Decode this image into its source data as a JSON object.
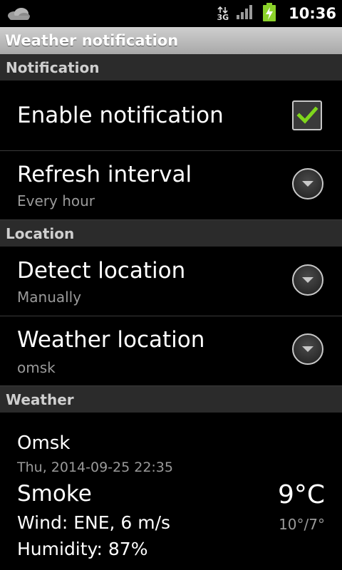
{
  "statusbar": {
    "network_type": "3G",
    "time": "10:36",
    "icons": [
      "weather-cloud-icon",
      "network-3g-icon",
      "signal-bars-icon",
      "battery-charging-icon"
    ]
  },
  "titlebar": {
    "title": "Weather notification"
  },
  "sections": {
    "notification": "Notification",
    "location": "Location",
    "weather": "Weather"
  },
  "prefs": {
    "enable_notification": {
      "title": "Enable notification",
      "checked": true
    },
    "refresh_interval": {
      "title": "Refresh interval",
      "summary": "Every hour"
    },
    "detect_location": {
      "title": "Detect location",
      "summary": "Manually"
    },
    "weather_location": {
      "title": "Weather location",
      "summary": "omsk"
    }
  },
  "weather": {
    "city": "Omsk",
    "datetime": "Thu, 2014-09-25 22:35",
    "condition": "Smoke",
    "wind": "Wind: ENE, 6 m/s",
    "humidity": "Humidity: 87%",
    "temperature": "9°C",
    "high_low": "10°/7°"
  },
  "colors": {
    "background": "#000000",
    "title_bar": "#b9b9b9",
    "section_header": "#2b2b2b",
    "checkmark": "#7fd61c",
    "battery": "#8bd22a",
    "secondary_text": "#9a9a9a"
  }
}
